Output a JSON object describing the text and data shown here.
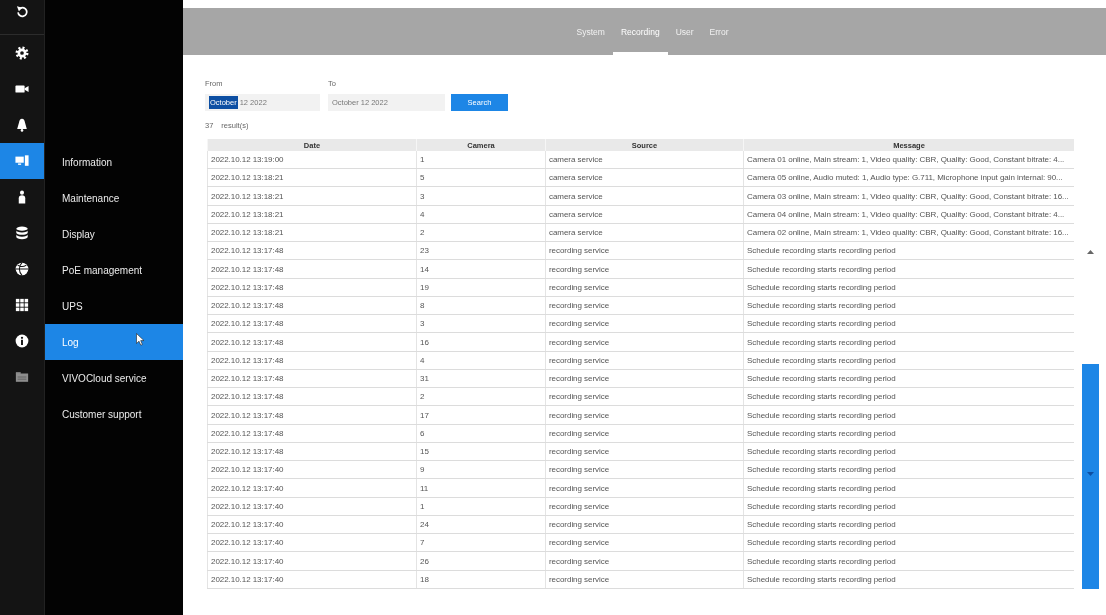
{
  "nav_icons": [
    {
      "kind": "back",
      "selected": false
    },
    {
      "kind": "gear",
      "selected": false
    },
    {
      "kind": "camera",
      "selected": false
    },
    {
      "kind": "alert",
      "selected": false
    },
    {
      "kind": "monitor",
      "selected": true
    },
    {
      "kind": "person",
      "selected": false
    },
    {
      "kind": "database",
      "selected": false
    },
    {
      "kind": "globe",
      "selected": false
    },
    {
      "kind": "grid",
      "selected": false
    },
    {
      "kind": "info",
      "selected": false
    },
    {
      "kind": "folder",
      "selected": false
    }
  ],
  "sidebar": {
    "items": [
      {
        "label": "Information",
        "selected": false
      },
      {
        "label": "Maintenance",
        "selected": false
      },
      {
        "label": "Display",
        "selected": false
      },
      {
        "label": "PoE management",
        "selected": false
      },
      {
        "label": "UPS",
        "selected": false
      },
      {
        "label": "Log",
        "selected": true
      },
      {
        "label": "VIVOCloud service",
        "selected": false
      },
      {
        "label": "Customer support",
        "selected": false
      }
    ]
  },
  "tabs": [
    {
      "label": "System",
      "selected": false
    },
    {
      "label": "Recording",
      "selected": true
    },
    {
      "label": "User",
      "selected": false
    },
    {
      "label": "Error",
      "selected": false
    }
  ],
  "search_form": {
    "from": {
      "label": "From",
      "selected_text": "October",
      "value": "12 2022"
    },
    "to": {
      "label": "To",
      "value": "October 12 2022"
    },
    "button": "Search"
  },
  "results": {
    "count": "37",
    "label": "result(s)"
  },
  "table": {
    "columns": [
      "Date",
      "Camera",
      "Source",
      "Message"
    ],
    "rows": [
      [
        "2022.10.12 13:19:00",
        "1",
        "camera service",
        "Camera 01 online, Main stream: 1, Video quality: CBR, Quality: Good, Constant bitrate: 4..."
      ],
      [
        "2022.10.12 13:18:21",
        "5",
        "camera service",
        "Camera 05 online, Audio muted: 1, Audio type: G.711, Microphone input gain internal: 90..."
      ],
      [
        "2022.10.12 13:18:21",
        "3",
        "camera service",
        "Camera 03 online, Main stream: 1, Video quality: CBR, Quality: Good, Constant bitrate: 16..."
      ],
      [
        "2022.10.12 13:18:21",
        "4",
        "camera service",
        "Camera 04 online, Main stream: 1, Video quality: CBR, Quality: Good, Constant bitrate: 4..."
      ],
      [
        "2022.10.12 13:18:21",
        "2",
        "camera service",
        "Camera 02 online, Main stream: 1, Video quality: CBR, Quality: Good, Constant bitrate: 16..."
      ],
      [
        "2022.10.12 13:17:48",
        "23",
        "recording service",
        "Schedule recording starts recording period"
      ],
      [
        "2022.10.12 13:17:48",
        "14",
        "recording service",
        "Schedule recording starts recording period"
      ],
      [
        "2022.10.12 13:17:48",
        "19",
        "recording service",
        "Schedule recording starts recording period"
      ],
      [
        "2022.10.12 13:17:48",
        "8",
        "recording service",
        "Schedule recording starts recording period"
      ],
      [
        "2022.10.12 13:17:48",
        "3",
        "recording service",
        "Schedule recording starts recording period"
      ],
      [
        "2022.10.12 13:17:48",
        "16",
        "recording service",
        "Schedule recording starts recording period"
      ],
      [
        "2022.10.12 13:17:48",
        "4",
        "recording service",
        "Schedule recording starts recording period"
      ],
      [
        "2022.10.12 13:17:48",
        "31",
        "recording service",
        "Schedule recording starts recording period"
      ],
      [
        "2022.10.12 13:17:48",
        "2",
        "recording service",
        "Schedule recording starts recording period"
      ],
      [
        "2022.10.12 13:17:48",
        "17",
        "recording service",
        "Schedule recording starts recording period"
      ],
      [
        "2022.10.12 13:17:48",
        "6",
        "recording service",
        "Schedule recording starts recording period"
      ],
      [
        "2022.10.12 13:17:48",
        "15",
        "recording service",
        "Schedule recording starts recording period"
      ],
      [
        "2022.10.12 13:17:40",
        "9",
        "recording service",
        "Schedule recording starts recording period"
      ],
      [
        "2022.10.12 13:17:40",
        "11",
        "recording service",
        "Schedule recording starts recording period"
      ],
      [
        "2022.10.12 13:17:40",
        "1",
        "recording service",
        "Schedule recording starts recording period"
      ],
      [
        "2022.10.12 13:17:40",
        "24",
        "recording service",
        "Schedule recording starts recording period"
      ],
      [
        "2022.10.12 13:17:40",
        "7",
        "recording service",
        "Schedule recording starts recording period"
      ],
      [
        "2022.10.12 13:17:40",
        "26",
        "recording service",
        "Schedule recording starts recording period"
      ],
      [
        "2022.10.12 13:17:40",
        "18",
        "recording service",
        "Schedule recording starts recording period"
      ]
    ]
  }
}
